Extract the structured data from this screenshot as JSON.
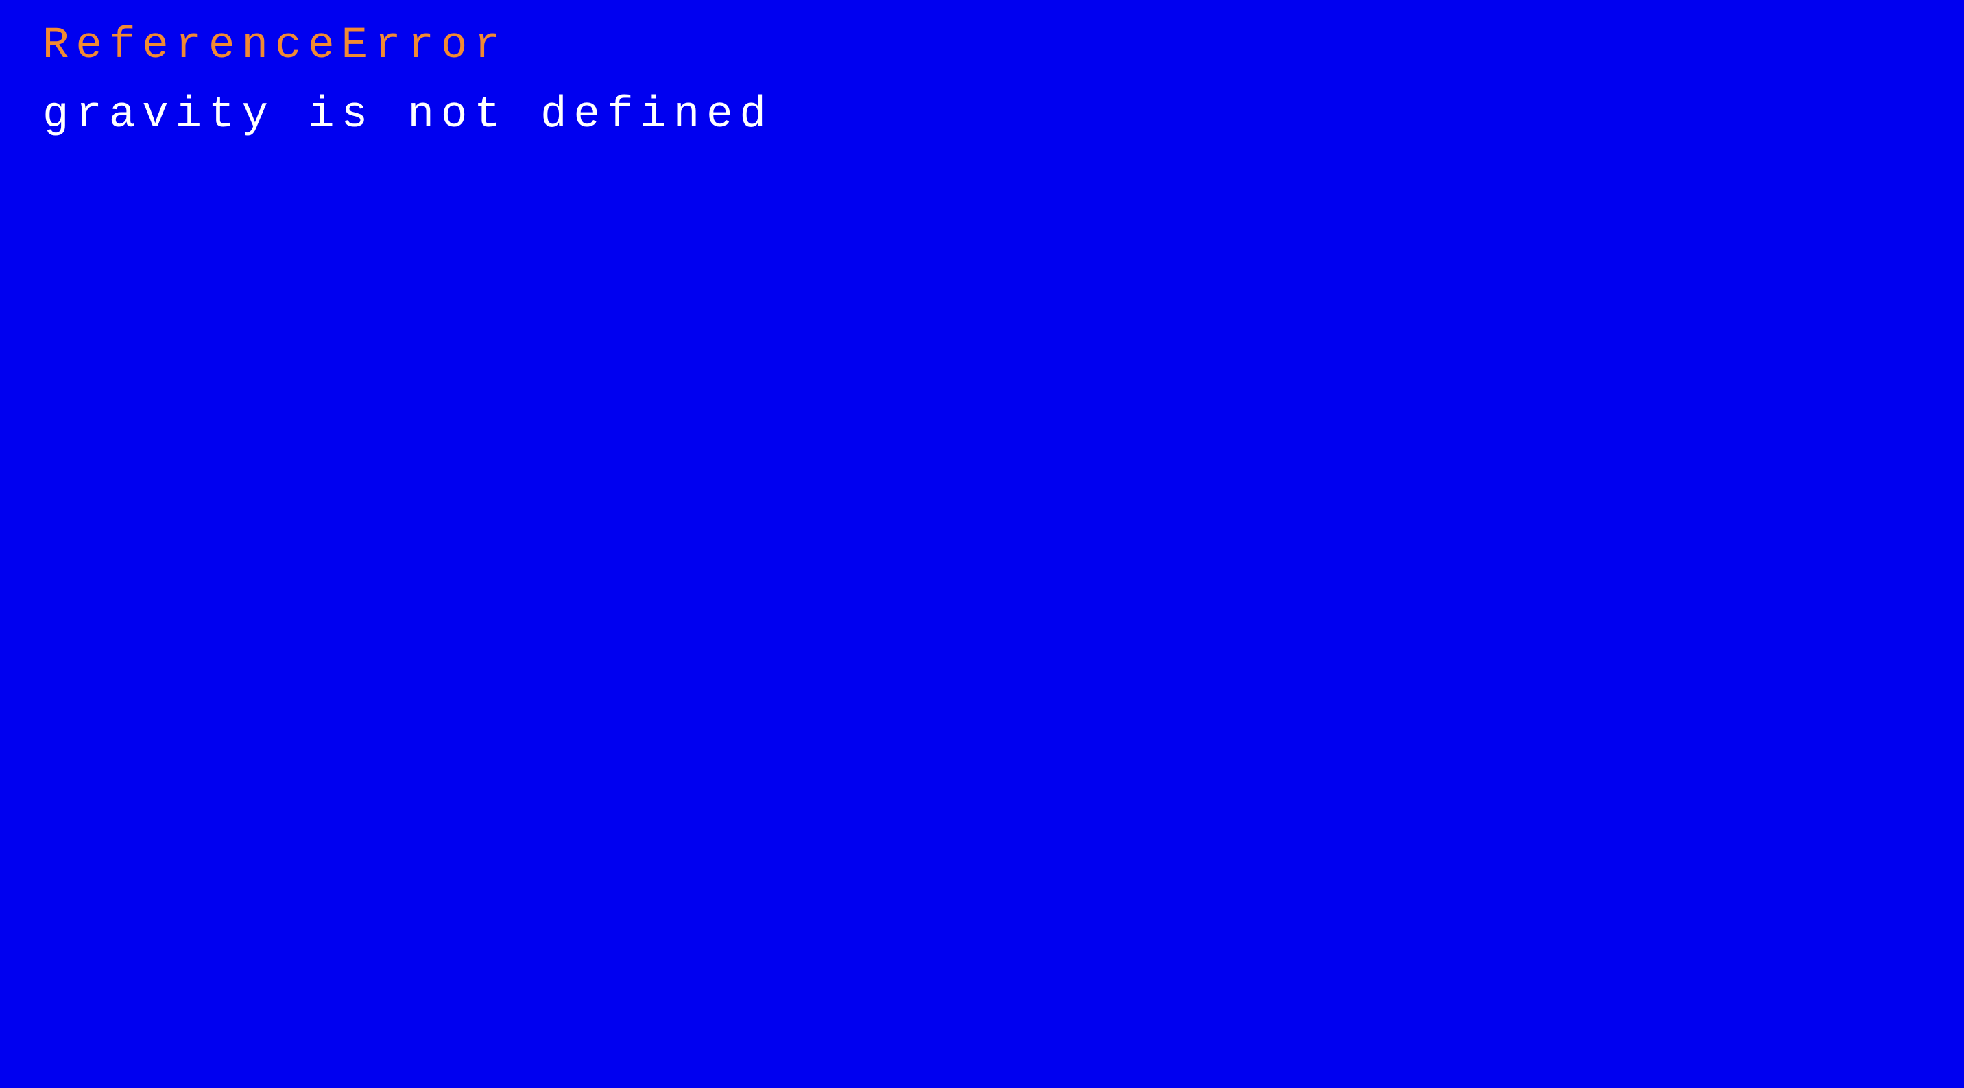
{
  "screen": {
    "background_color": "#0000f0"
  },
  "error": {
    "type": "ReferenceError",
    "message": "gravity is not defined",
    "type_color": "#f28a32",
    "message_color": "#ffffff"
  }
}
